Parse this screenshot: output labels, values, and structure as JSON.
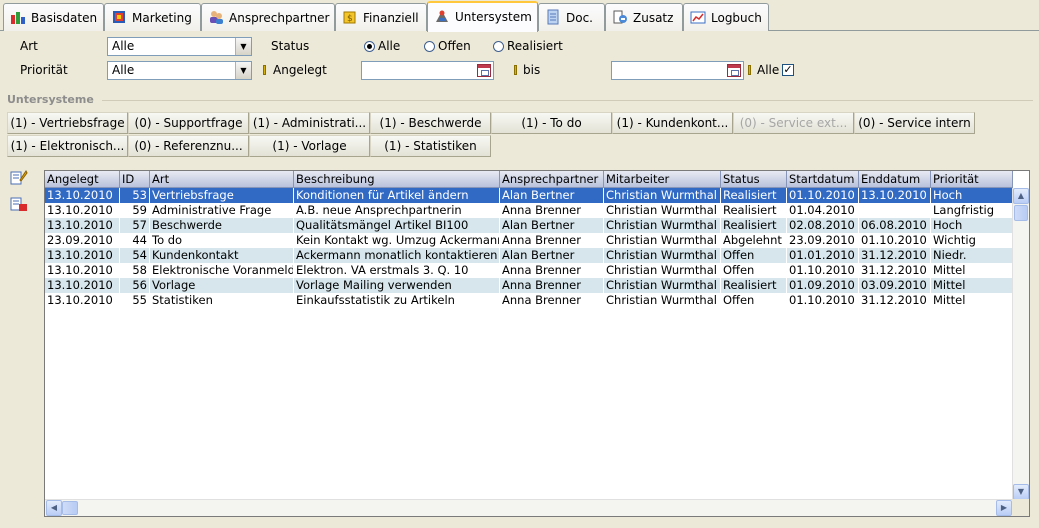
{
  "tabs": [
    {
      "label": "Basisdaten",
      "icon": "chart-people-icon"
    },
    {
      "label": "Marketing",
      "icon": "marketing-book-icon"
    },
    {
      "label": "Ansprechpartner",
      "icon": "contacts-icon"
    },
    {
      "label": "Finanziell",
      "icon": "money-icon"
    },
    {
      "label": "Untersystem",
      "icon": "tools-icon"
    },
    {
      "label": "Doc.",
      "icon": "document-icon"
    },
    {
      "label": "Zusatz",
      "icon": "extra-icon"
    },
    {
      "label": "Logbuch",
      "icon": "logbook-chart-icon"
    }
  ],
  "active_tab": "Untersystem",
  "filters": {
    "art_label": "Art",
    "art_value": "Alle",
    "prioritaet_label": "Priorität",
    "prioritaet_value": "Alle",
    "status_label": "Status",
    "status_options": [
      "Alle",
      "Offen",
      "Realisiert"
    ],
    "status_selected": "Alle",
    "angelegt_label": "Angelegt",
    "angelegt_from": "",
    "bis_label": "bis",
    "angelegt_to": "",
    "alle_label": "Alle",
    "alle_checked": true
  },
  "untersysteme": {
    "title": "Untersysteme",
    "buttons": [
      {
        "label": "(1) - Vertriebsfrage",
        "enabled": true
      },
      {
        "label": "(0) - Supportfrage",
        "enabled": true
      },
      {
        "label": "(1) - Administrati...",
        "enabled": true
      },
      {
        "label": "(1) - Beschwerde",
        "enabled": true
      },
      {
        "label": "(1) - To do",
        "enabled": true
      },
      {
        "label": "(1) - Kundenkont...",
        "enabled": true
      },
      {
        "label": "(0) - Service ext...",
        "enabled": false
      },
      {
        "label": "(0) - Service intern",
        "enabled": true
      },
      {
        "label": "(1) - Elektronisch...",
        "enabled": true
      },
      {
        "label": "(0) - Referenznu...",
        "enabled": true
      },
      {
        "label": "(1) - Vorlage",
        "enabled": true
      },
      {
        "label": "(1) - Statistiken",
        "enabled": true
      }
    ]
  },
  "grid": {
    "columns": [
      "Angelegt",
      "ID",
      "Art",
      "Beschreibung",
      "Ansprechpartner",
      "Mitarbeiter",
      "Status",
      "Startdatum",
      "Enddatum",
      "Priorität"
    ],
    "rows": [
      [
        "13.10.2010",
        "53",
        "Vertriebsfrage",
        "Konditionen für Artikel ändern",
        "Alan Bertner",
        "Christian Wurmthal",
        "Realisiert",
        "01.10.2010",
        "13.10.2010",
        "Hoch"
      ],
      [
        "13.10.2010",
        "59",
        "Administrative Frage",
        "A.B. neue Ansprechpartnerin",
        "Anna Brenner",
        "Christian Wurmthal",
        "Realisiert",
        "01.04.2010",
        "",
        "Langfristig"
      ],
      [
        "13.10.2010",
        "57",
        "Beschwerde",
        "Qualitätsmängel Artikel BI100",
        "Alan Bertner",
        "Christian Wurmthal",
        "Realisiert",
        "02.08.2010",
        "06.08.2010",
        "Hoch"
      ],
      [
        "23.09.2010",
        "44",
        "To do",
        "Kein Kontakt wg. Umzug Ackermann",
        "Anna Brenner",
        "Christian Wurmthal",
        "Abgelehnt",
        "23.09.2010",
        "01.10.2010",
        "Wichtig"
      ],
      [
        "13.10.2010",
        "54",
        "Kundenkontakt",
        "Ackermann monatlich kontaktieren",
        "Alan Bertner",
        "Christian Wurmthal",
        "Offen",
        "01.01.2010",
        "31.12.2010",
        "Niedr."
      ],
      [
        "13.10.2010",
        "58",
        "Elektronische Voranmeldung",
        "Elektron. VA erstmals 3. Q. 10",
        "Anna Brenner",
        "Christian Wurmthal",
        "Offen",
        "01.10.2010",
        "31.12.2010",
        "Mittel"
      ],
      [
        "13.10.2010",
        "56",
        "Vorlage",
        "Vorlage Mailing verwenden",
        "Anna Brenner",
        "Christian Wurmthal",
        "Realisiert",
        "01.09.2010",
        "03.09.2010",
        "Mittel"
      ],
      [
        "13.10.2010",
        "55",
        "Statistiken",
        "Einkaufsstatistik zu Artikeln",
        "Anna Brenner",
        "Christian Wurmthal",
        "Offen",
        "01.10.2010",
        "31.12.2010",
        "Mittel"
      ]
    ],
    "selected_row": 0
  },
  "colors": {
    "selection": "#316ac5",
    "alt_row": "#d6e6ec",
    "active_tab_accent": "#ffc83c"
  }
}
